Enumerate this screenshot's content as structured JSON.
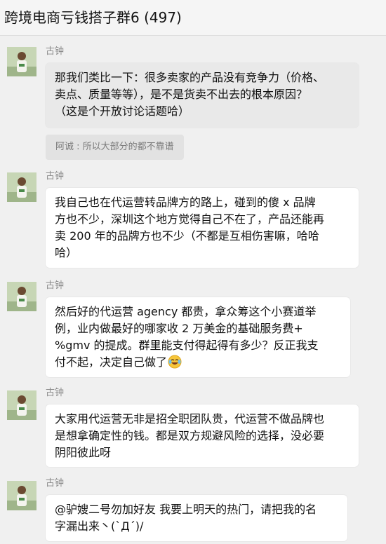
{
  "window": {
    "title": "跨境电商亏钱搭子群6 (497)"
  },
  "messages": [
    {
      "sender": "古钟",
      "lines": [
        "那我们类比一下：很多卖家的产品没有竞争力（价格、",
        "卖点、质量等等），是不是货卖不出去的根本原因？",
        "（这是个开放讨论话题哈）"
      ]
    },
    {
      "sender": "古钟",
      "lines": [
        "我自己也在代运营转品牌方的路上，碰到的傻 x 品牌",
        "方也不少，深圳这个地方觉得自己不在了，产品还能再",
        "卖 200 年的品牌方也不少（不都是互相伤害嘛，哈哈",
        "哈）"
      ]
    },
    {
      "sender": "古钟",
      "lines": [
        "然后好的代运营 agency 都贵，拿众筹这个小赛道举",
        "例，业内做最好的哪家收 2 万美金的基础服务费+",
        "%gmv 的提成。群里能支付得起得有多少？反正我支",
        "付不起，决定自己做了"
      ],
      "emoji": "laughing-crying-emoji"
    },
    {
      "sender": "古钟",
      "lines": [
        "大家用代运营无非是招全职团队贵，代运营不做品牌也",
        "是想拿确定性的钱。都是双方规避风险的选择，没必要",
        "阴阳彼此呀"
      ]
    },
    {
      "sender": "古钟",
      "lines": [
        "@驴嫂二号勿加好友 我要上明天的热门，请把我的名",
        "字漏出来丶(`Д´)/"
      ]
    }
  ],
  "quote": {
    "text": "阿诚 : 所以大部分的都不靠谱"
  },
  "colors": {
    "background": "#f0f0f0",
    "bubble": "#ffffff",
    "selected_bubble": "#e9e9e9",
    "sender_text": "#8b8b8b"
  }
}
